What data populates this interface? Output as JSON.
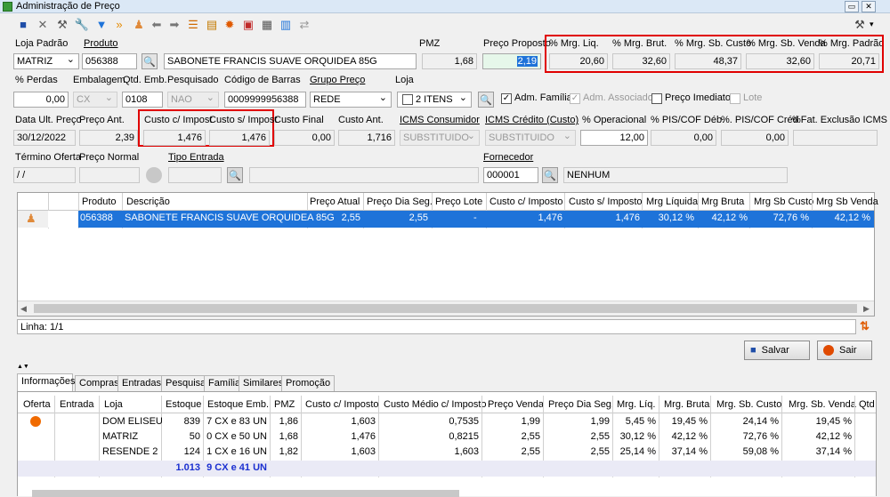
{
  "window": {
    "title": "Administração de Preço"
  },
  "labels": {
    "loja_padrao": "Loja Padrão",
    "produto": "Produto",
    "pmz": "PMZ",
    "preco_proposto": "Preço Proposto",
    "mrg_liq": "% Mrg. Liq.",
    "mrg_brut": "% Mrg. Brut.",
    "mrg_sb_custo": "% Mrg. Sb. Custo",
    "mrg_sb_venda": "% Mrg. Sb. Venda",
    "mrg_padrao": "% Mrg. Padrão",
    "perdas": "% Perdas",
    "embalagem": "Embalagem",
    "qtd_emb": "Qtd. Emb.",
    "pesquisado": "Pesquisado",
    "codigo_barras": "Código de Barras",
    "grupo_preco": "Grupo Preço",
    "loja": "Loja",
    "adm_familia": "Adm. Família",
    "adm_associado": "Adm. Associado",
    "preco_imediato": "Preço Imediato",
    "lote": "Lote",
    "data_ult_preco": "Data Ult. Preço",
    "preco_ant": "Preço Ant.",
    "custo_c_impost": "Custo c/ Impost",
    "custo_s_impost": "Custo s/ Impost",
    "custo_final": "Custo Final",
    "custo_ant": "Custo Ant.",
    "icms_consumidor": "ICMS Consumidor",
    "icms_credito": "ICMS Crédito (Custo)",
    "operacional": "% Operacional",
    "pis_cof_deb": "% PIS/COF Déb.",
    "pis_cof_cred": "%. PIS/COF Créd",
    "fat_exclusao": "%Fat. Exclusão ICMS",
    "termino_oferta": "Término Oferta",
    "preco_normal": "Preço Normal",
    "tipo_entrada": "Tipo Entrada",
    "fornecedor": "Fornecedor"
  },
  "fields": {
    "loja_padrao": "MATRIZ",
    "produto_codigo": "056388",
    "produto_descricao": "SABONETE FRANCIS SUAVE ORQUIDEA 85G",
    "pmz": "1,68",
    "preco_proposto": "2,19",
    "mrg_liq": "20,60",
    "mrg_brut": "32,60",
    "mrg_sb_custo": "48,37",
    "mrg_sb_venda": "32,60",
    "mrg_padrao": "20,71",
    "perdas": "0,00",
    "embalagem": "CX",
    "qtd_emb": "0108",
    "pesquisado": "NAO",
    "codigo_barras": "0009999956388",
    "grupo_preco": "REDE",
    "loja": "2 ITENS",
    "data_ult_preco": "30/12/2022",
    "preco_ant": "2,39",
    "custo_c_impost": "1,476",
    "custo_s_impost": "1,476",
    "custo_final": "0,00",
    "custo_ant": "1,716",
    "icms_consumidor": "SUBSTITUIDO",
    "icms_credito": "SUBSTITUIDO",
    "operacional": "12,00",
    "pis_cof_deb": "0,00",
    "pis_cof_cred": "0,00",
    "fat_exclusao": "",
    "termino_oferta": "/ /",
    "preco_normal": "",
    "tipo_entrada": "",
    "fornecedor_codigo": "000001",
    "fornecedor_nome": "NENHUM"
  },
  "checkboxes": {
    "adm_familia": "✓",
    "adm_associado": "✓",
    "preco_imediato": "",
    "lote": ""
  },
  "grid": {
    "headers": [
      "Produto",
      "Descrição",
      "Preço Atual",
      "Preço Dia Seg.",
      "Preço Lote",
      "Custo c/ Imposto",
      "Custo s/ Imposto",
      "Mrg Líquida",
      "Mrg Bruta",
      "Mrg Sb Custo",
      "Mrg Sb Venda"
    ],
    "row": [
      "056388",
      "SABONETE FRANCIS SUAVE ORQUIDEA 85G",
      "2,55",
      "2,55",
      "-",
      "1,476",
      "1,476",
      "30,12 %",
      "42,12 %",
      "72,76 %",
      "42,12 %"
    ],
    "status": "Linha: 1/1"
  },
  "buttons": {
    "salvar": "Salvar",
    "sair": "Sair"
  },
  "tabs": [
    "Informações",
    "Compras",
    "Entradas",
    "Pesquisa",
    "Família",
    "Similares",
    "Promoção"
  ],
  "info_table": {
    "headers": [
      "Oferta",
      "Entrada",
      "Loja",
      "Estoque",
      "Estoque Emb.",
      "PMZ",
      "Custo c/ Imposto",
      "Custo Médio c/ Imposto",
      "Preço Venda",
      "Preço Dia Seg.",
      "Mrg. Líq.",
      "Mrg. Bruta",
      "Mrg. Sb. Custo",
      "Mrg. Sb. Venda",
      "Qtd"
    ],
    "rows": [
      [
        "DOM ELISEU",
        "839",
        "7 CX e 83 UN",
        "1,86",
        "1,603",
        "0,7535",
        "1,99",
        "1,99",
        "5,45 %",
        "19,45 %",
        "24,14 %",
        "19,45 %"
      ],
      [
        "MATRIZ",
        "50",
        "0 CX e 50 UN",
        "1,68",
        "1,476",
        "0,8215",
        "2,55",
        "2,55",
        "30,12 %",
        "42,12 %",
        "72,76 %",
        "42,12 %"
      ],
      [
        "RESENDE 2",
        "124",
        "1 CX e 16 UN",
        "1,82",
        "1,603",
        "1,603",
        "2,55",
        "2,55",
        "25,14 %",
        "37,14 %",
        "59,08 %",
        "37,14 %"
      ]
    ],
    "totals": [
      "1.013",
      "9 CX e 41 UN"
    ]
  },
  "colors": {
    "highlight_red": "#e00000",
    "selection_blue": "#1e73d9",
    "total_blue": "#1a2fd0"
  }
}
